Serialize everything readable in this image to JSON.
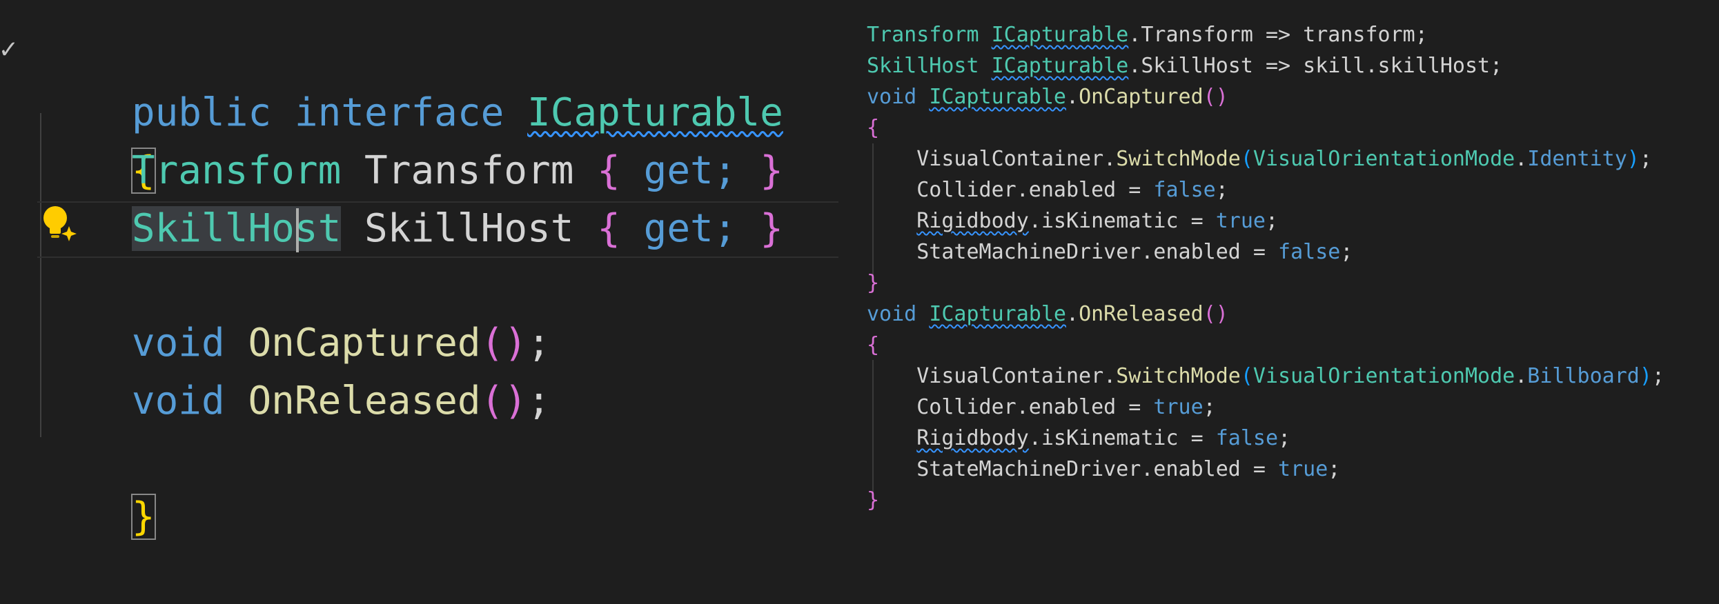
{
  "left": {
    "fold_icon": "check-fold-icon",
    "lightbulb_icon": "lightbulb-sparkle-icon",
    "line1": {
      "kw1": "public",
      "kw2": "interface",
      "name": "ICapturable"
    },
    "line2": {
      "brace": "{"
    },
    "line3": {
      "type": "Transform",
      "name": "Transform",
      "open": "{",
      "acc": "get;",
      "close": "}"
    },
    "line4": {
      "type_a": "SkillHo",
      "type_b": "st",
      "name": "SkillHost",
      "open": "{",
      "acc": "get;",
      "close": "}"
    },
    "line5": {
      "kw": "void",
      "name": "OnCaptured",
      "parens": "()",
      "semi": ";"
    },
    "line6": {
      "kw": "void",
      "name": "OnReleased",
      "parens": "()",
      "semi": ";"
    },
    "line7": {
      "brace": "}"
    }
  },
  "right": {
    "r1": {
      "t1": "Transform",
      "t2": "ICapturable",
      "rest": ".Transform => transform;"
    },
    "r2": {
      "t1": "SkillHost",
      "t2": "ICapturable",
      "rest": ".SkillHost => skill.skillHost;"
    },
    "r3": {
      "kw": "void",
      "iface": "ICapturable",
      "dot": ".",
      "name": "OnCaptured",
      "parens": "()"
    },
    "r4": {
      "brace": "{"
    },
    "r5": {
      "obj": "VisualContainer.",
      "method": "SwitchMode",
      "open": "(",
      "enum": "VisualOrientationMode",
      "dot": ".",
      "member": "Identity",
      "close": ")",
      "semi": ";"
    },
    "r6": {
      "lhs": "Collider.enabled = ",
      "val": "false",
      "semi": ";"
    },
    "r7": {
      "obj": "Rigidbody",
      "lhs": ".isKinematic = ",
      "val": "true",
      "semi": ";"
    },
    "r8": {
      "lhs": "StateMachineDriver.enabled = ",
      "val": "false",
      "semi": ";"
    },
    "r9": {
      "brace": "}"
    },
    "r10": {
      "kw": "void",
      "iface": "ICapturable",
      "dot": ".",
      "name": "OnReleased",
      "parens": "()"
    },
    "r11": {
      "brace": "{"
    },
    "r12": {
      "obj": "VisualContainer.",
      "method": "SwitchMode",
      "open": "(",
      "enum": "VisualOrientationMode",
      "dot": ".",
      "member": "Billboard",
      "close": ")",
      "semi": ";"
    },
    "r13": {
      "lhs": "Collider.enabled = ",
      "val": "true",
      "semi": ";"
    },
    "r14": {
      "obj": "Rigidbody",
      "lhs": ".isKinematic = ",
      "val": "false",
      "semi": ";"
    },
    "r15": {
      "lhs": "StateMachineDriver.enabled = ",
      "val": "true",
      "semi": ";"
    },
    "r16": {
      "brace": "}"
    }
  }
}
